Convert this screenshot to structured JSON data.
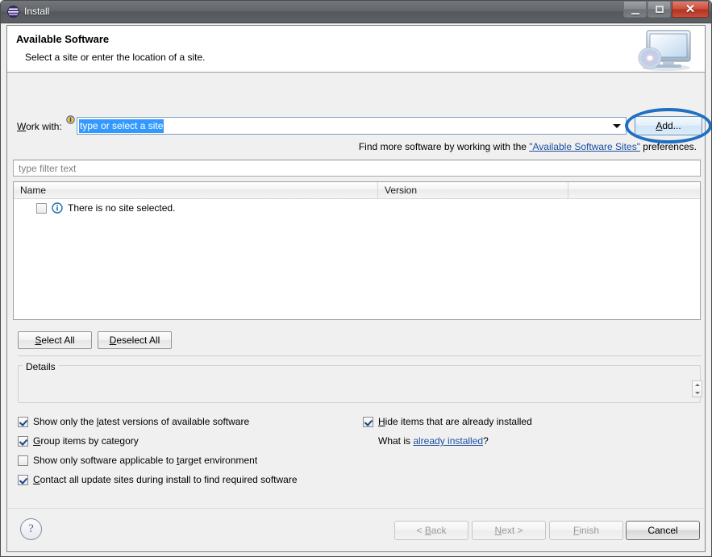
{
  "window": {
    "title": "Install",
    "app_icon": "eclipse-icon",
    "buttons": {
      "minimize": "minimize-icon",
      "maximize": "maximize-icon",
      "close": "close-icon"
    }
  },
  "header": {
    "title": "Available Software",
    "subtitle": "Select a site or enter the location of a site.",
    "art_icon": "monitor-disc-icon"
  },
  "work_with": {
    "label_prefix": "W",
    "label_rest": "ork with:",
    "info_icon": "info-icon",
    "value": "type or select a site",
    "dropdown_icon": "chevron-down-icon",
    "add_button": {
      "prefix": "A",
      "rest": "dd...",
      "highlighted": true,
      "highlight_color": "#1f6fc4"
    }
  },
  "hint": {
    "before": "Find more software by working with the ",
    "link": "\"Available Software Sites\"",
    "after": " preferences."
  },
  "filter": {
    "placeholder": "type filter text",
    "value": ""
  },
  "table": {
    "columns": [
      "Name",
      "Version",
      ""
    ],
    "rows": [
      {
        "checked": false,
        "icon": "info-icon",
        "name": "There is no site selected.",
        "version": ""
      }
    ]
  },
  "list_buttons": {
    "select_all": {
      "prefix": "S",
      "rest": "elect All"
    },
    "deselect_all": {
      "prefix": "D",
      "rest": "eselect All"
    }
  },
  "details": {
    "group_label": "Details",
    "content": "",
    "spinner_icon": "spinner-updown-icon"
  },
  "options": {
    "left": [
      {
        "checked": true,
        "pre": "Show only the ",
        "mn": "l",
        "post": "atest versions of available software"
      },
      {
        "checked": true,
        "pre": "",
        "mn": "G",
        "post": "roup items by category"
      },
      {
        "checked": false,
        "pre": "Show only software applicable to ",
        "mn": "t",
        "post": "arget environment"
      },
      {
        "checked": true,
        "pre": "",
        "mn": "C",
        "post": "ontact all update sites during install to find required software"
      }
    ],
    "right": [
      {
        "checked": true,
        "pre": "",
        "mn": "H",
        "post": "ide items that are already installed"
      }
    ],
    "what_is": {
      "before": "What is ",
      "link": "already installed",
      "after": "?"
    }
  },
  "footer": {
    "help_icon": "help-icon",
    "back": {
      "pre": "< ",
      "mn": "B",
      "post": "ack",
      "enabled": false
    },
    "next": {
      "pre": "",
      "mn": "N",
      "post": "ext >",
      "enabled": false
    },
    "finish": {
      "pre": "",
      "mn": "F",
      "post": "inish",
      "enabled": false
    },
    "cancel": {
      "pre": "",
      "mn": "",
      "post": "Cancel",
      "enabled": true
    }
  }
}
